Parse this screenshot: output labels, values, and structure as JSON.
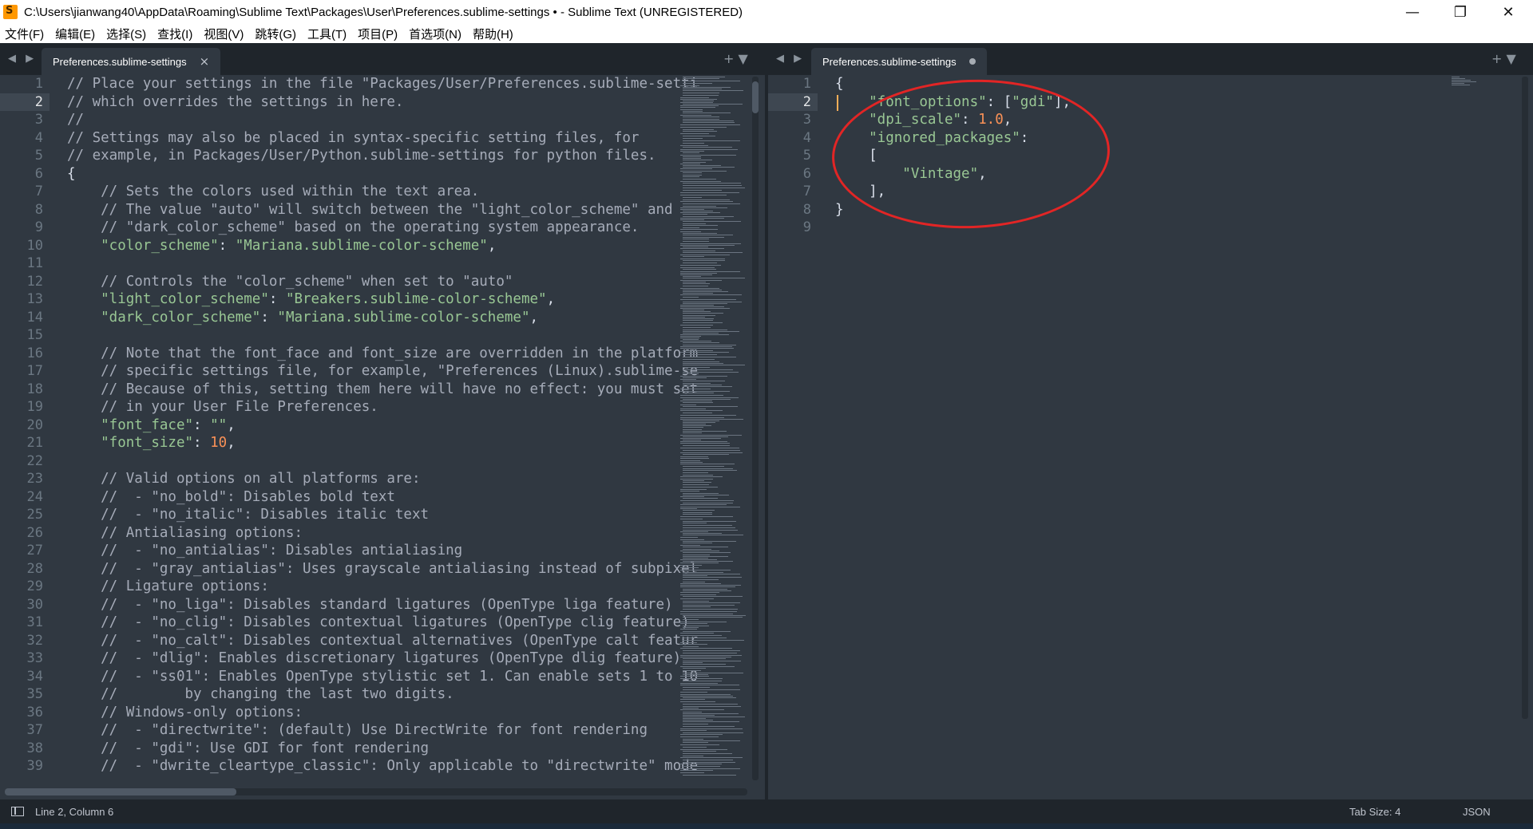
{
  "window": {
    "title": "C:\\Users\\jianwang40\\AppData\\Roaming\\Sublime Text\\Packages\\User\\Preferences.sublime-settings • - Sublime Text (UNREGISTERED)",
    "minimize": "—",
    "maximize": "❐",
    "close": "✕"
  },
  "menu": [
    "文件(F)",
    "编辑(E)",
    "选择(S)",
    "查找(I)",
    "视图(V)",
    "跳转(G)",
    "工具(T)",
    "项目(P)",
    "首选项(N)",
    "帮助(H)"
  ],
  "left_pane": {
    "tab_nav": "◀ ▶",
    "tab_label": "Preferences.sublime-settings",
    "tab_close": "×",
    "tab_actions": "+ ▼",
    "active_line": 2,
    "lines": [
      [
        [
          "cm",
          "// Place your settings in the file \"Packages/User/Preferences.sublime-setti"
        ]
      ],
      [
        [
          "cm",
          "// which overrides the settings in here."
        ]
      ],
      [
        [
          "cm",
          "//"
        ]
      ],
      [
        [
          "cm",
          "// Settings may also be placed in syntax-specific setting files, for"
        ]
      ],
      [
        [
          "cm",
          "// example, in Packages/User/Python.sublime-settings for python files."
        ]
      ],
      [
        [
          "br",
          "{"
        ]
      ],
      [
        [
          "cm",
          "    // Sets the colors used within the text area."
        ]
      ],
      [
        [
          "cm",
          "    // The value \"auto\" will switch between the \"light_color_scheme\" and"
        ]
      ],
      [
        [
          "cm",
          "    // \"dark_color_scheme\" based on the operating system appearance."
        ]
      ],
      [
        [
          "str",
          "    \"color_scheme\""
        ],
        [
          "br",
          ": "
        ],
        [
          "str",
          "\"Mariana.sublime-color-scheme\""
        ],
        [
          "br",
          ","
        ]
      ],
      [
        [
          "br",
          ""
        ]
      ],
      [
        [
          "cm",
          "    // Controls the \"color_scheme\" when set to \"auto\""
        ]
      ],
      [
        [
          "str",
          "    \"light_color_scheme\""
        ],
        [
          "br",
          ": "
        ],
        [
          "str",
          "\"Breakers.sublime-color-scheme\""
        ],
        [
          "br",
          ","
        ]
      ],
      [
        [
          "str",
          "    \"dark_color_scheme\""
        ],
        [
          "br",
          ": "
        ],
        [
          "str",
          "\"Mariana.sublime-color-scheme\""
        ],
        [
          "br",
          ","
        ]
      ],
      [
        [
          "br",
          ""
        ]
      ],
      [
        [
          "cm",
          "    // Note that the font_face and font_size are overridden in the platform"
        ]
      ],
      [
        [
          "cm",
          "    // specific settings file, for example, \"Preferences (Linux).sublime-se"
        ]
      ],
      [
        [
          "cm",
          "    // Because of this, setting them here will have no effect: you must set"
        ]
      ],
      [
        [
          "cm",
          "    // in your User File Preferences."
        ]
      ],
      [
        [
          "str",
          "    \"font_face\""
        ],
        [
          "br",
          ": "
        ],
        [
          "str",
          "\"\""
        ],
        [
          "br",
          ","
        ]
      ],
      [
        [
          "str",
          "    \"font_size\""
        ],
        [
          "br",
          ": "
        ],
        [
          "num",
          "10"
        ],
        [
          "br",
          ","
        ]
      ],
      [
        [
          "br",
          ""
        ]
      ],
      [
        [
          "cm",
          "    // Valid options on all platforms are:"
        ]
      ],
      [
        [
          "cm",
          "    //  - \"no_bold\": Disables bold text"
        ]
      ],
      [
        [
          "cm",
          "    //  - \"no_italic\": Disables italic text"
        ]
      ],
      [
        [
          "cm",
          "    // Antialiasing options:"
        ]
      ],
      [
        [
          "cm",
          "    //  - \"no_antialias\": Disables antialiasing"
        ]
      ],
      [
        [
          "cm",
          "    //  - \"gray_antialias\": Uses grayscale antialiasing instead of subpixel"
        ]
      ],
      [
        [
          "cm",
          "    // Ligature options:"
        ]
      ],
      [
        [
          "cm",
          "    //  - \"no_liga\": Disables standard ligatures (OpenType liga feature)"
        ]
      ],
      [
        [
          "cm",
          "    //  - \"no_clig\": Disables contextual ligatures (OpenType clig feature)"
        ]
      ],
      [
        [
          "cm",
          "    //  - \"no_calt\": Disables contextual alternatives (OpenType calt featur"
        ]
      ],
      [
        [
          "cm",
          "    //  - \"dlig\": Enables discretionary ligatures (OpenType dlig feature)"
        ]
      ],
      [
        [
          "cm",
          "    //  - \"ss01\": Enables OpenType stylistic set 1. Can enable sets 1 to 10"
        ]
      ],
      [
        [
          "cm",
          "    //        by changing the last two digits."
        ]
      ],
      [
        [
          "cm",
          "    // Windows-only options:"
        ]
      ],
      [
        [
          "cm",
          "    //  - \"directwrite\": (default) Use DirectWrite for font rendering"
        ]
      ],
      [
        [
          "cm",
          "    //  - \"gdi\": Use GDI for font rendering"
        ]
      ],
      [
        [
          "cm",
          "    //  - \"dwrite_cleartype_classic\": Only applicable to \"directwrite\" mode"
        ]
      ]
    ]
  },
  "right_pane": {
    "tab_nav": "◀ ▶",
    "tab_label": "Preferences.sublime-settings",
    "tab_actions": "+ ▼",
    "active_line": 2,
    "lines": [
      [
        [
          "br",
          "{"
        ]
      ],
      [
        [
          "str",
          "    \"font_options\""
        ],
        [
          "br",
          ": ["
        ],
        [
          "str",
          "\"gdi\""
        ],
        [
          "br",
          "],"
        ]
      ],
      [
        [
          "str",
          "    \"dpi_scale\""
        ],
        [
          "br",
          ": "
        ],
        [
          "num",
          "1.0"
        ],
        [
          "br",
          ","
        ]
      ],
      [
        [
          "str",
          "    \"ignored_packages\""
        ],
        [
          "br",
          ":"
        ]
      ],
      [
        [
          "br",
          "    ["
        ]
      ],
      [
        [
          "str",
          "        \"Vintage\""
        ],
        [
          "br",
          ","
        ]
      ],
      [
        [
          "br",
          "    ],"
        ]
      ],
      [
        [
          "br",
          "}"
        ]
      ],
      [
        [
          "br",
          ""
        ]
      ]
    ]
  },
  "status": {
    "position": "Line 2, Column 6",
    "tab_size": "Tab Size: 4",
    "syntax": "JSON"
  },
  "colors": {
    "background": "#303841",
    "comment": "#a6acb9",
    "string": "#99c794",
    "number": "#f99157",
    "annotation": "#e22525"
  }
}
